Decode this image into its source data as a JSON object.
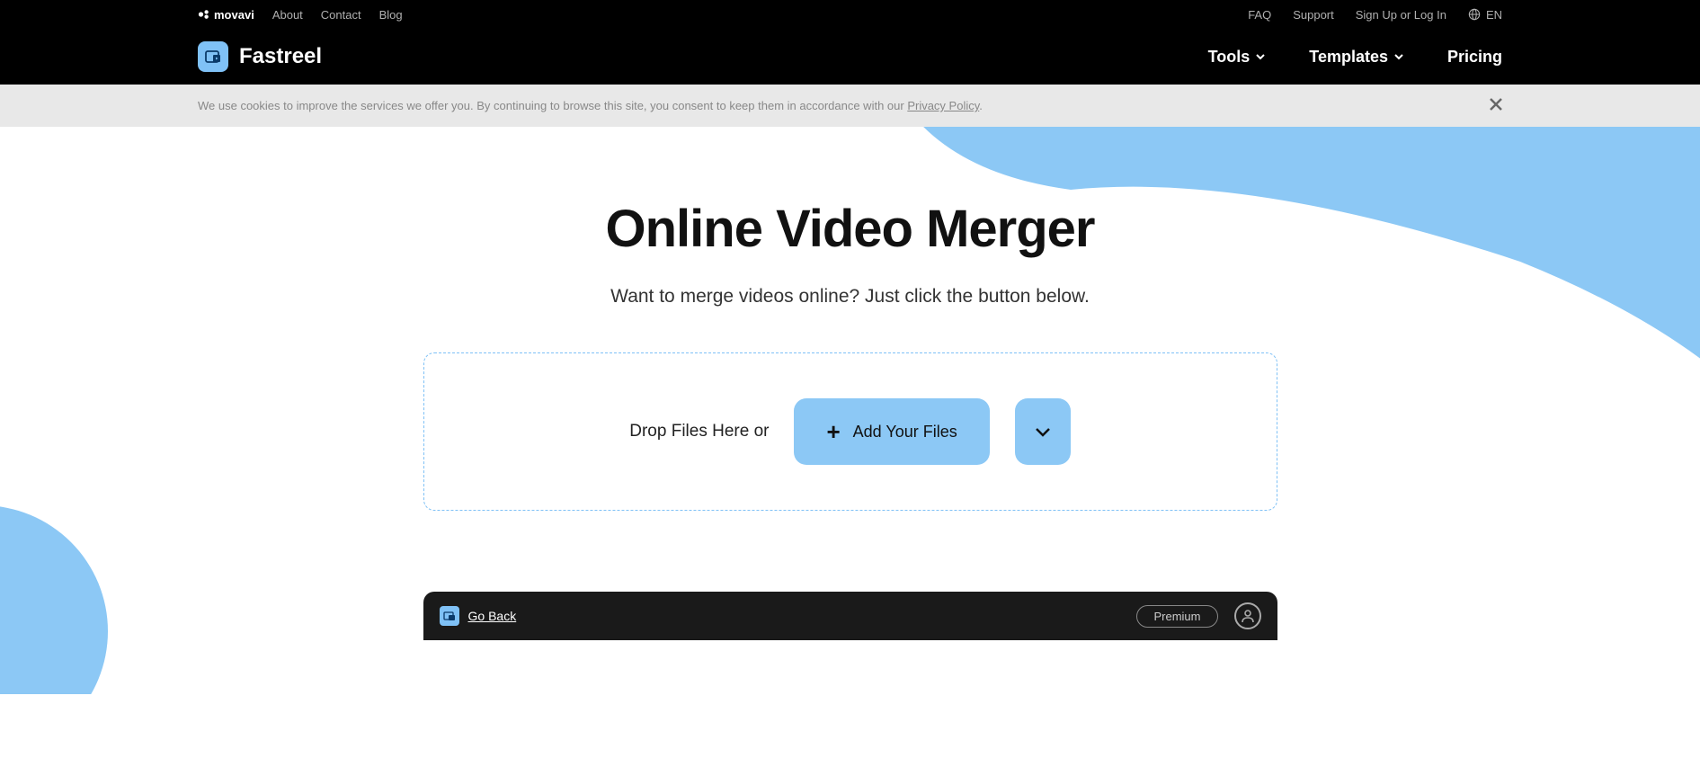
{
  "top_bar": {
    "brand": "movavi",
    "links": [
      "About",
      "Contact",
      "Blog"
    ],
    "right_links": [
      "FAQ",
      "Support",
      "Sign Up or Log In"
    ],
    "lang": "EN"
  },
  "nav": {
    "brand": "Fastreel",
    "items": [
      {
        "label": "Tools",
        "dropdown": true
      },
      {
        "label": "Templates",
        "dropdown": true
      },
      {
        "label": "Pricing",
        "dropdown": false
      }
    ]
  },
  "cookie": {
    "text": "We use cookies to improve the services we offer you. By continuing to browse this site, you consent to keep them in accordance with our ",
    "link_text": "Privacy Policy",
    "suffix": "."
  },
  "hero": {
    "title": "Online Video Merger",
    "subtitle": "Want to merge videos online? Just click the button below.",
    "drop_text": "Drop Files Here or",
    "add_files_label": "Add Your Files"
  },
  "bottom": {
    "go_back": "Go Back",
    "premium": "Premium"
  },
  "colors": {
    "accent": "#8cc8f5",
    "dark": "#000000"
  }
}
